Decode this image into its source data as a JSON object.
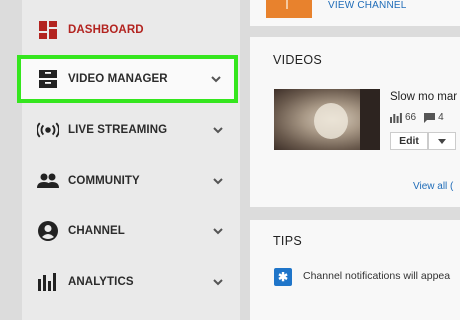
{
  "sidebar": {
    "items": [
      {
        "label": "DASHBOARD",
        "icon": "dashboard-icon"
      },
      {
        "label": "VIDEO MANAGER",
        "icon": "video-manager-icon"
      },
      {
        "label": "LIVE STREAMING",
        "icon": "live-streaming-icon"
      },
      {
        "label": "COMMUNITY",
        "icon": "community-icon"
      },
      {
        "label": "CHANNEL",
        "icon": "channel-icon"
      },
      {
        "label": "ANALYTICS",
        "icon": "analytics-icon"
      }
    ],
    "accent_color": "#b32420",
    "highlight_color": "#35e61e"
  },
  "channel_panel": {
    "view_channel_label": "VIEW CHANNEL",
    "block_color": "#e8822d"
  },
  "videos_panel": {
    "title": "VIDEOS",
    "video": {
      "title": "Slow mo mar",
      "views": "66",
      "comments": "4",
      "edit_label": "Edit"
    },
    "view_all_label": "View all ("
  },
  "tips_panel": {
    "title": "TIPS",
    "tip_text": "Channel notifications will appea"
  }
}
